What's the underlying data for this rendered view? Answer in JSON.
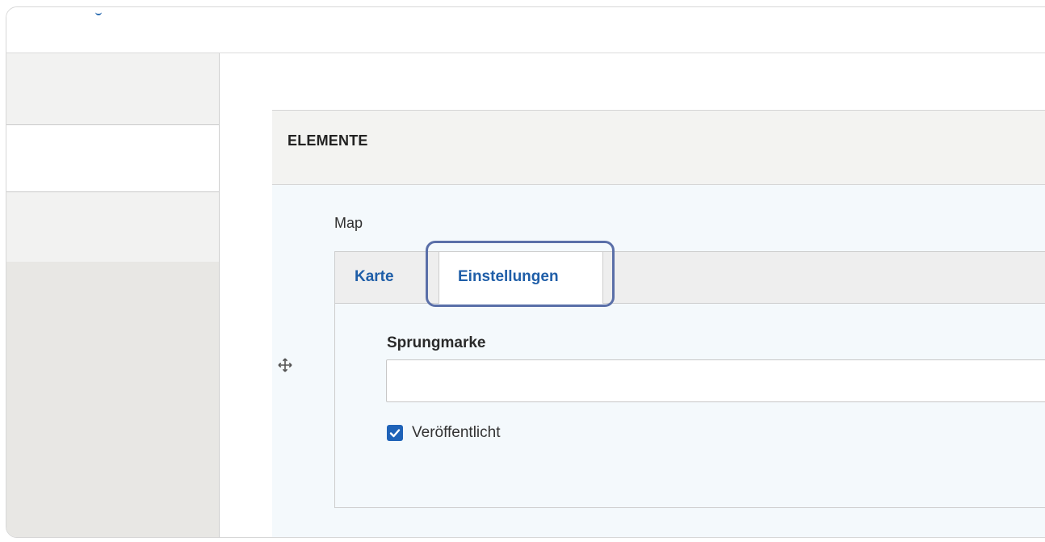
{
  "panel": {
    "title": "ELEMENTE"
  },
  "paragraph": {
    "label": "Map",
    "drag_icon": "move-icon"
  },
  "tabs": [
    {
      "label": "Karte",
      "active": false
    },
    {
      "label": "Einstellungen",
      "active": true
    }
  ],
  "settings": {
    "anchor_label": "Sprungmarke",
    "anchor_value": "",
    "published_label": "Veröffentlicht",
    "published_checked": true
  },
  "colors": {
    "accent": "#1f5ea8",
    "focus_ring": "#5a6fa8",
    "checkbox": "#1f63b8"
  }
}
